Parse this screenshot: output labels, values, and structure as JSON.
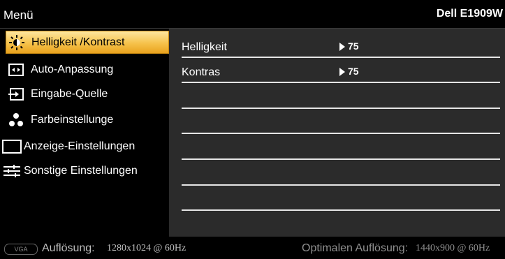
{
  "header": {
    "title": "Menü",
    "model": "Dell E1909W"
  },
  "sidebar": {
    "items": [
      {
        "label": "Helligkeit /Kontrast",
        "icon": "brightness-icon",
        "active": true
      },
      {
        "label": "Auto-Anpassung",
        "icon": "auto-adjust-icon",
        "active": false
      },
      {
        "label": "Eingabe-Quelle",
        "icon": "input-source-icon",
        "active": false
      },
      {
        "label": "Farbeinstellunge",
        "icon": "color-settings-icon",
        "active": false
      },
      {
        "label": "Anzeige-Einstellungen",
        "icon": "display-settings-icon",
        "active": false
      },
      {
        "label": "Sonstige Einstellungen",
        "icon": "other-settings-icon",
        "active": false
      }
    ]
  },
  "panel": {
    "rows": [
      {
        "name": "Helligkeit",
        "value": "75"
      },
      {
        "name": "Kontras",
        "value": "75"
      }
    ]
  },
  "status": {
    "connector": "VGA",
    "resolution_label": "Auflösung:",
    "resolution_value": "1280x1024 @ 60Hz",
    "optimal_label": "Optimalen Auflösung:",
    "optimal_value": "1440x900 @ 60Hz"
  },
  "colors": {
    "highlight": "#f6c24b",
    "panel_bg": "#2b2b2b",
    "background": "#000000"
  }
}
